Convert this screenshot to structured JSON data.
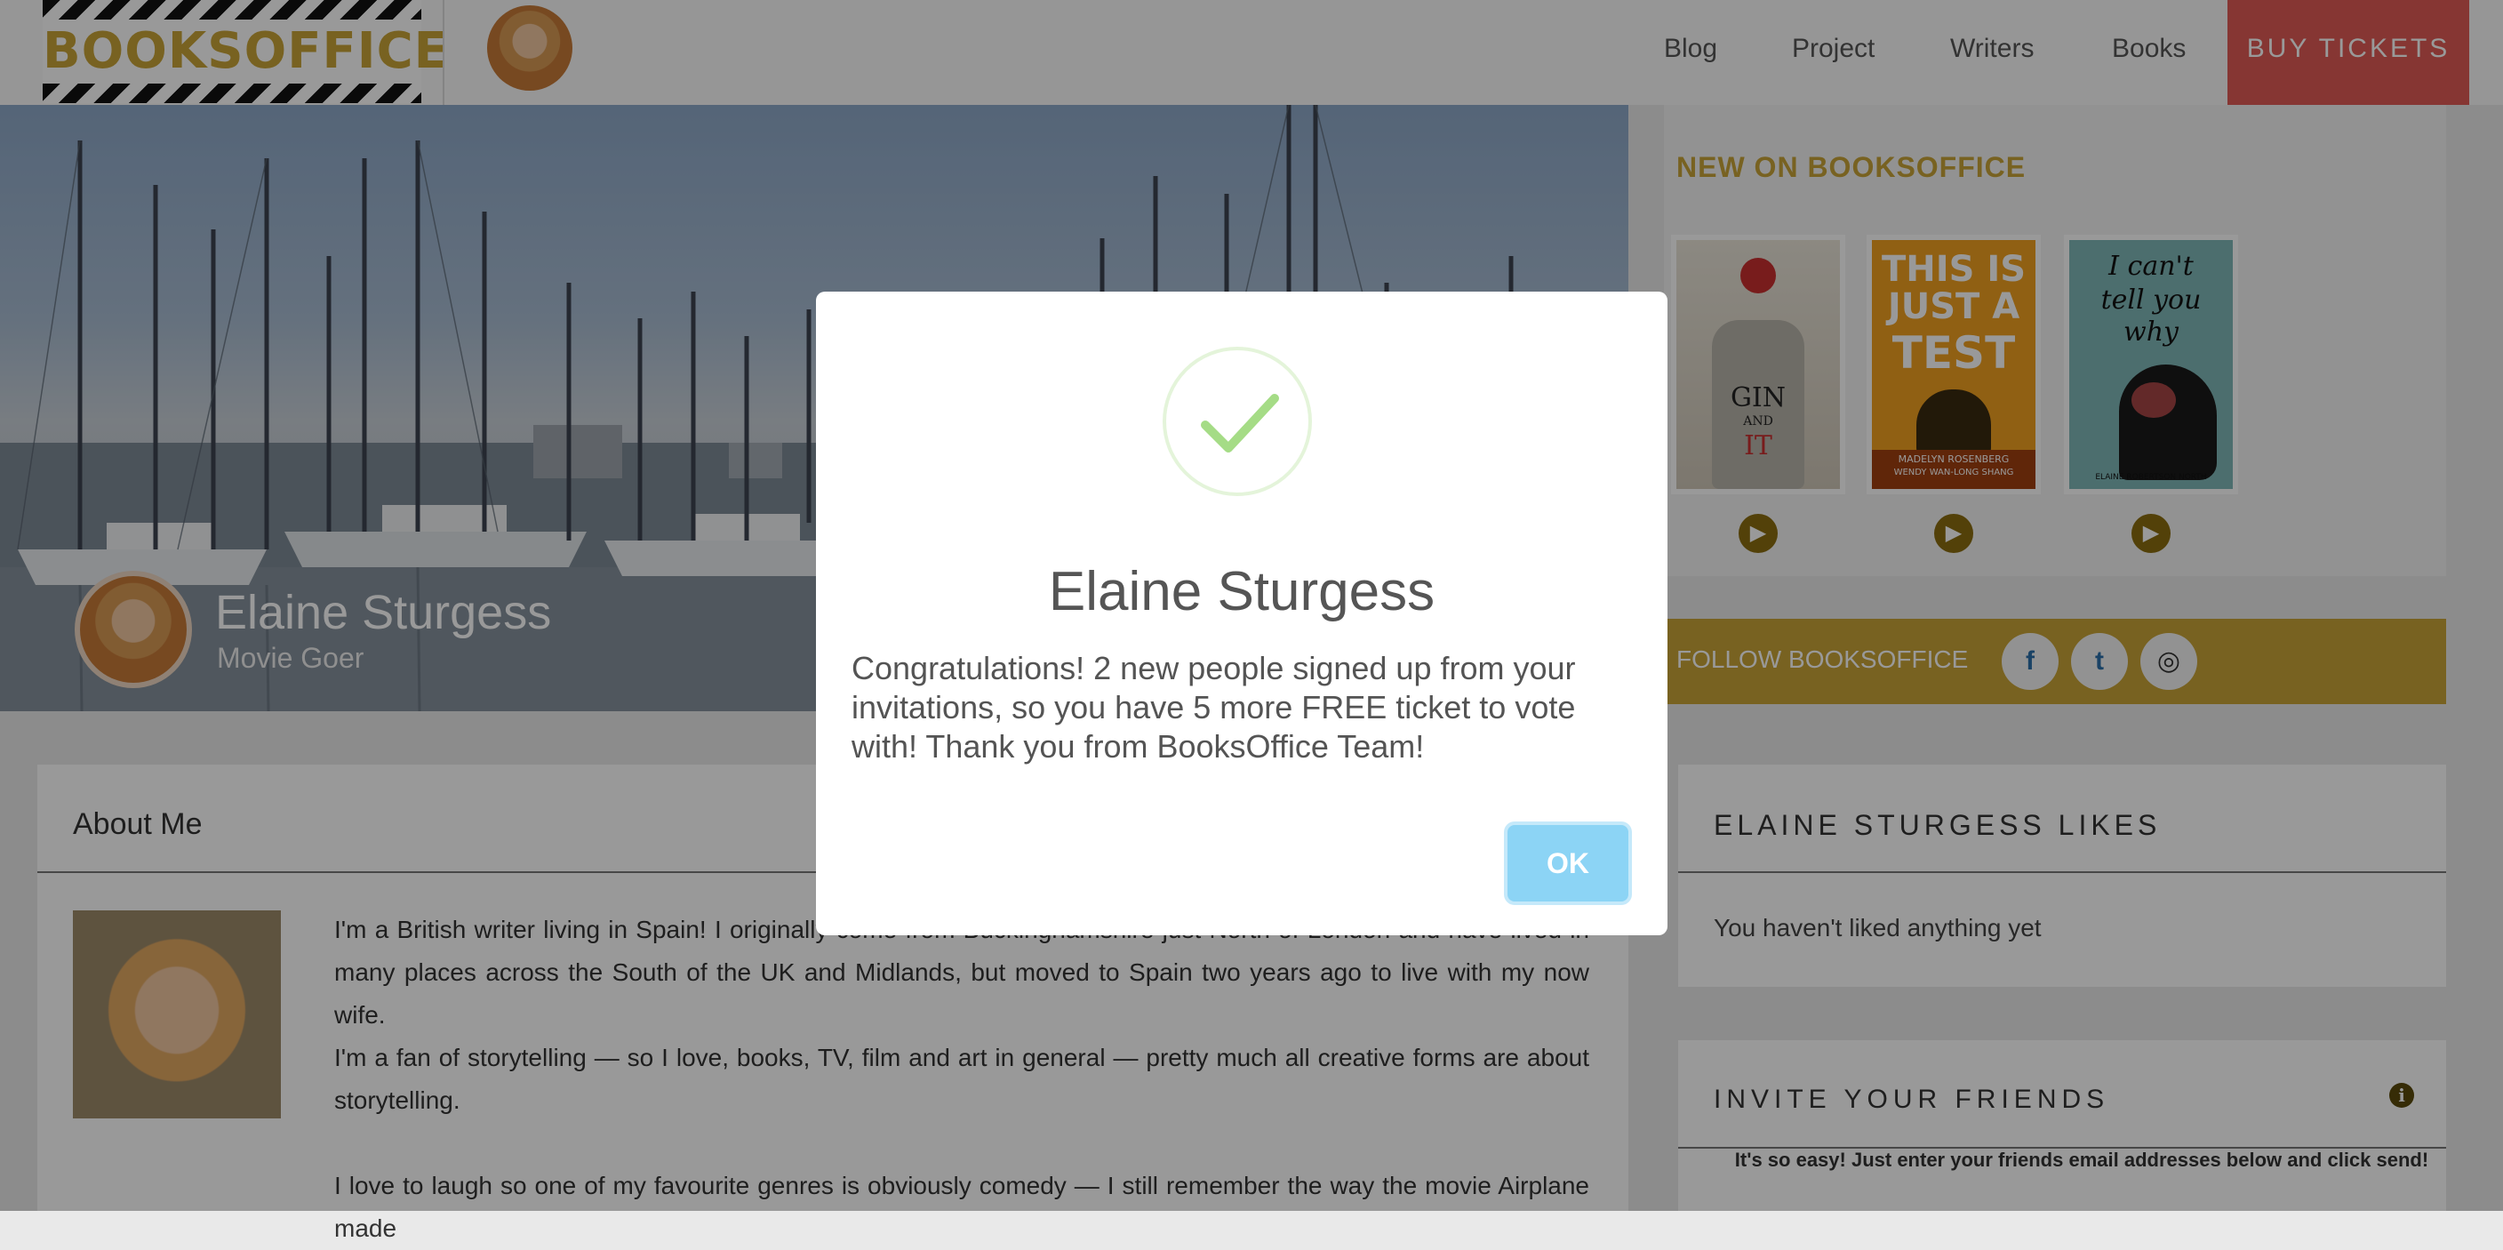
{
  "header": {
    "logo_text": "BOOKSOFFICE",
    "nav": [
      "Blog",
      "Project",
      "Writers",
      "Books"
    ],
    "buy_label": "BUY TICKETS"
  },
  "hero": {
    "name": "Elaine Sturgess",
    "role": "Movie Goer"
  },
  "sidebar": {
    "new_title": "NEW ON BOOKSOFFICE",
    "books": [
      {
        "cover_line1": "GIN",
        "cover_line2": "AND",
        "cover_line3": "IT",
        "colors": [
          "#e9e4d8",
          "#c93030"
        ]
      },
      {
        "cover_line1": "THIS IS",
        "cover_line2": "JUST A",
        "cover_line3": "TEST",
        "cover_line4": "MADELYN ROSENBERG",
        "cover_line5": "WENDY WAN-LONG SHANG",
        "colors": [
          "#f0a020",
          "#3a2a10"
        ]
      },
      {
        "cover_line1": "I can't",
        "cover_line2": "tell you",
        "cover_line3": "why",
        "cover_line4": "ELAINE ROBERTSON NORTH",
        "colors": [
          "#7fb8b8",
          "#1a1a1a"
        ]
      }
    ],
    "follow_label": "FOLLOW BOOKSOFFICE",
    "social": [
      {
        "name": "facebook-icon",
        "glyph": "f"
      },
      {
        "name": "twitter-icon",
        "glyph": "t"
      },
      {
        "name": "instagram-icon",
        "glyph": "◎"
      }
    ],
    "likes_title": "ELAINE STURGESS LIKES",
    "likes_text": "You haven't liked anything yet",
    "invite_title": "INVITE YOUR FRIENDS",
    "invite_text": "It's so easy! Just enter your friends email addresses below and click send!"
  },
  "about": {
    "title": "About Me",
    "paragraphs": [
      "I'm a British writer living in Spain! I originally come from Buckinghamshire just North of London and have lived in many places across the South of the UK and Midlands, but moved to Spain two years ago to live with my now wife.",
      "I'm a fan of storytelling — so I love, books, TV, film and art in general — pretty much all creative forms are about storytelling.",
      "I love to laugh so one of my favourite genres is obviously comedy — I still remember the way the movie Airplane made"
    ]
  },
  "modal": {
    "title": "Elaine Sturgess",
    "message": "Congratulations! 2 new people signed up from your invitations, so you have 5 more FREE ticket to vote with! Thank you from BooksOffice Team!",
    "ok_label": "OK",
    "accent": "#a5dc86"
  }
}
